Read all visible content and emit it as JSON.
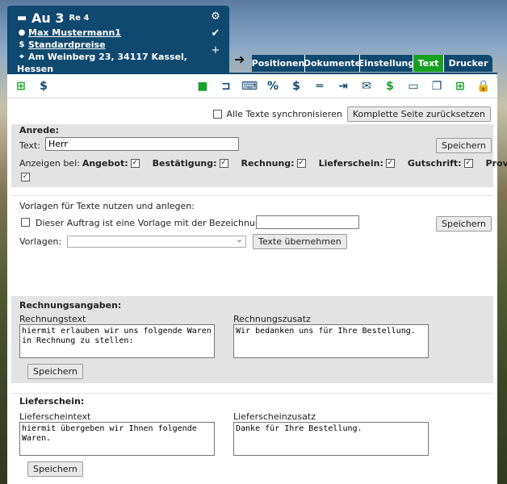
{
  "header": {
    "order_title": "Au 3",
    "order_ref": "Re 4",
    "customer_name": "Max Mustermann1",
    "price_list": "Standardpreise",
    "address_line1": "Am Weinberg 23, 34117 Kassel,",
    "address_line2": "Hessen"
  },
  "tabs": [
    {
      "label": "Positionen"
    },
    {
      "label": "Dokumente"
    },
    {
      "label": "Einstellung"
    },
    {
      "label": "Text"
    },
    {
      "label": "Drucker"
    }
  ],
  "top_controls": {
    "sync_label": "Alle Texte synchronisieren",
    "reset_label": "Komplette Seite zurücksetzen"
  },
  "anrede": {
    "heading": "Anrede:",
    "text_label": "Text:",
    "text_value": "Herr",
    "save_label": "Speichern",
    "show_label": "Anzeigen bei:",
    "options": [
      {
        "label": "Angebot:",
        "checked": true
      },
      {
        "label": "Bestätigung:",
        "checked": true
      },
      {
        "label": "Rechnung:",
        "checked": true
      },
      {
        "label": "Lieferschein:",
        "checked": true
      },
      {
        "label": "Gutschrift:",
        "checked": true
      },
      {
        "label": "Prov.:",
        "checked": true
      }
    ]
  },
  "vorlagen": {
    "heading": "Vorlagen für Texte nutzen und anlegen:",
    "template_checkbox_label": "Dieser Auftrag ist eine Vorlage mit der Bezeichnung:",
    "template_name_value": "",
    "save_label": "Speichern",
    "select_label": "Vorlagen:",
    "select_value": "",
    "apply_label": "Texte übernehmen"
  },
  "rechnung": {
    "heading": "Rechnungsangaben:",
    "text_label": "Rechnungstext",
    "text_value": "hiermit erlauben wir uns folgende Waren in Rechnung zu stellen:",
    "extra_label": "Rechnungszusatz",
    "extra_value": "Wir bedanken uns für Ihre Bestellung.",
    "save_label": "Speichern"
  },
  "lieferschein": {
    "heading": "Lieferschein:",
    "text_label": "Lieferscheintext",
    "text_value": "hiermit übergeben wir Ihnen folgende Waren.",
    "extra_label": "Lieferscheinzusatz",
    "extra_value": "Danke für Ihre Bestellung.",
    "save_label": "Speichern"
  },
  "icons": {
    "folder": "folder-icon",
    "user": "user-icon",
    "dollar": "dollar-icon",
    "marker": "map-marker-icon",
    "user_settings": "user-settings-icon",
    "user_check": "user-check-icon",
    "user_add": "user-add-icon"
  },
  "colors": {
    "header_bg": "#10496f",
    "active_tab": "#17a021",
    "green_icon": "#19a12a"
  }
}
